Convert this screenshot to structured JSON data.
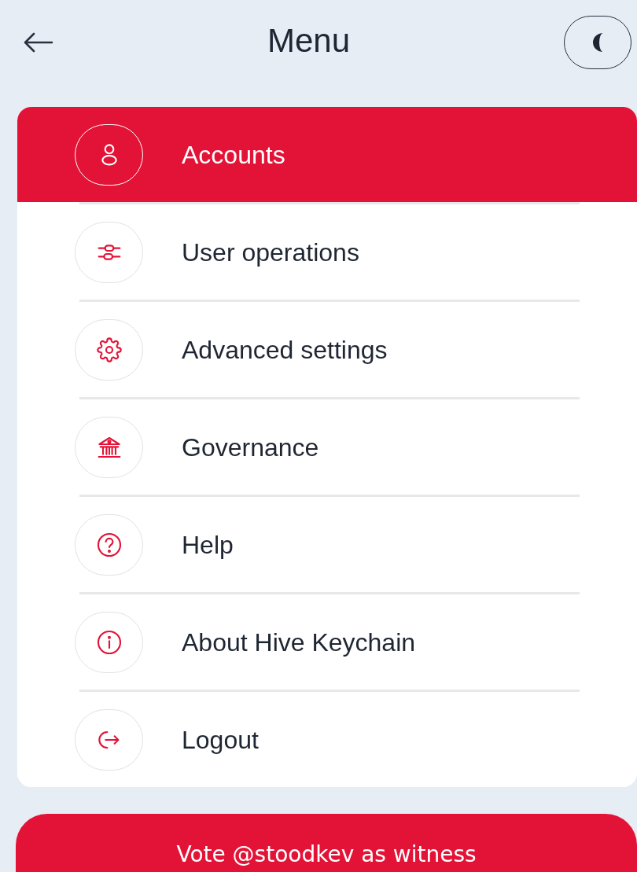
{
  "header": {
    "title": "Menu"
  },
  "menu": {
    "items": [
      {
        "label": "Accounts",
        "kind": "accounts",
        "selected": true
      },
      {
        "label": "User operations",
        "kind": "operations",
        "selected": false
      },
      {
        "label": "Advanced settings",
        "kind": "settings",
        "selected": false
      },
      {
        "label": "Governance",
        "kind": "governance",
        "selected": false
      },
      {
        "label": "Help",
        "kind": "help",
        "selected": false
      },
      {
        "label": "About Hive Keychain",
        "kind": "about",
        "selected": false
      },
      {
        "label": "Logout",
        "kind": "logout",
        "selected": false
      }
    ]
  },
  "vote_button": {
    "label": "Vote @stoodkev as witness"
  }
}
